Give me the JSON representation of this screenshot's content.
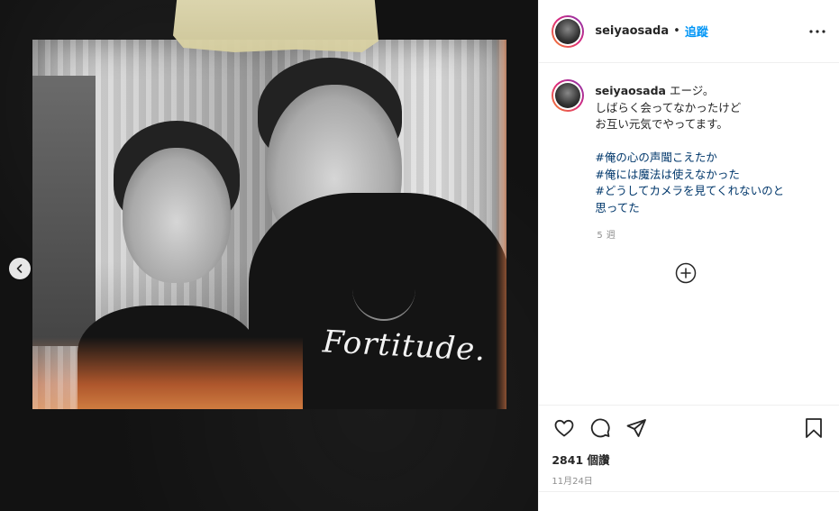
{
  "post": {
    "username": "seiyaosada",
    "follow_label": "追蹤",
    "caption_lines": [
      "エージ。",
      "しばらく会ってなかったけど",
      "お互い元気でやってます。"
    ],
    "hashtags": [
      "#俺の心の声聞こえたか",
      "#俺には魔法は使えなかった",
      "#どうしてカメラを見てくれないのと"
    ],
    "hashtag_continuation": "思ってた",
    "time_ago": "5 週",
    "views": "2841 個讚",
    "date": "11月24日"
  },
  "media": {
    "shirt_text": "Fortitude."
  },
  "colors": {
    "link_blue": "#0095f6",
    "hashtag_blue": "#00376b",
    "text": "#262626",
    "muted": "#8e8e8e",
    "divider": "#efefef"
  },
  "icons": {
    "more": "more-horizontal-icon",
    "like": "heart-icon",
    "comment": "comment-icon",
    "share": "share-icon",
    "save": "bookmark-icon",
    "load_more": "plus-circle-icon",
    "prev": "chevron-left-icon"
  }
}
